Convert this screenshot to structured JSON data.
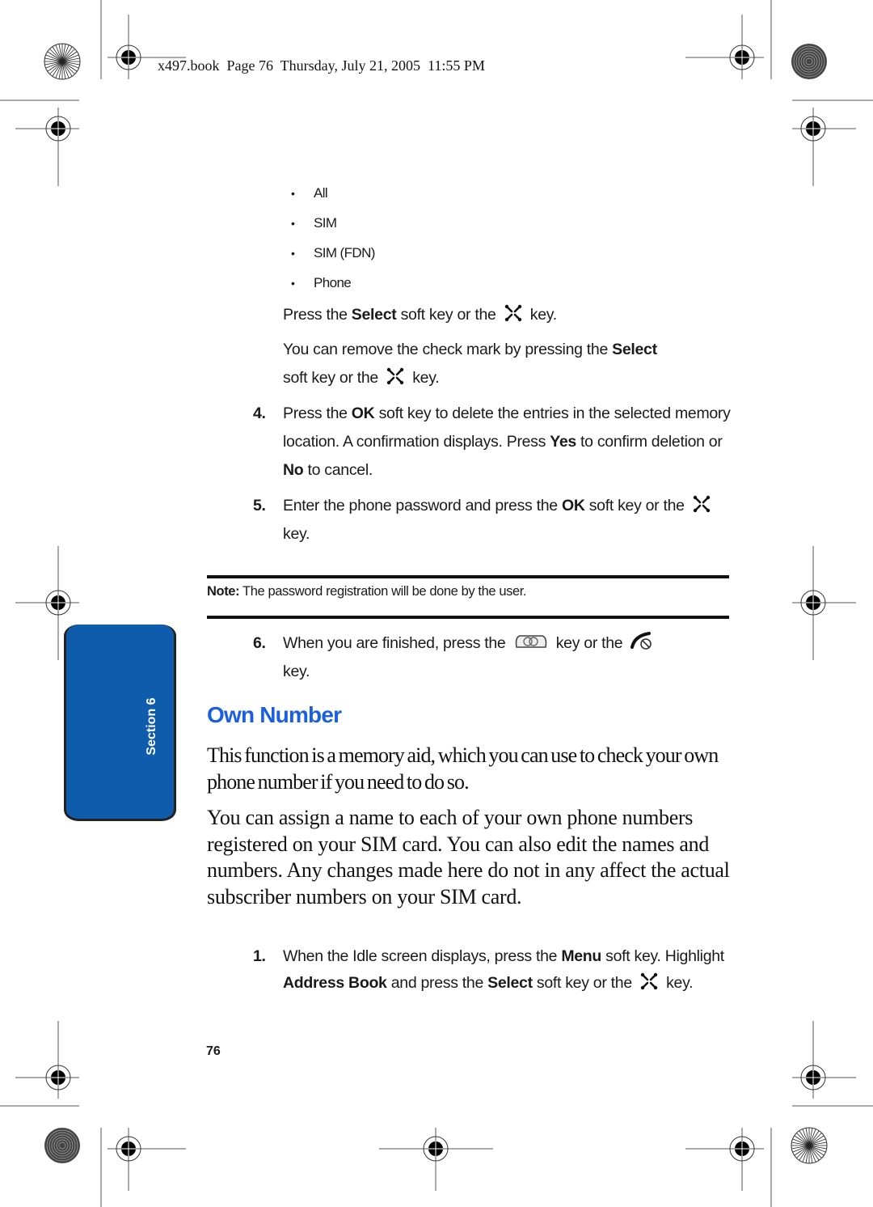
{
  "header": {
    "running_head": "x497.book  Page 76  Thursday, July 21, 2005  11:55 PM"
  },
  "bullets": [
    "All",
    "SIM",
    "SIM (FDN)",
    "Phone"
  ],
  "press_select": {
    "pre": "Press the ",
    "bold": "Select",
    "mid": " soft key or the ",
    "post": " key."
  },
  "remove_check": {
    "pre": "You can remove the check mark by pressing the ",
    "bold": "Select",
    "line2_pre": "soft key or the ",
    "post": " key."
  },
  "steps_top": [
    {
      "number": "4.",
      "parts": [
        "Press the ",
        "OK",
        " soft key to delete the entries in the selected memory location. A confirmation displays. Press ",
        "Yes",
        " to confirm deletion or ",
        "No",
        " to cancel."
      ]
    },
    {
      "number": "5.",
      "parts": [
        "Enter the phone password and press the ",
        "OK",
        " soft key or the ",
        " key."
      ]
    },
    {
      "number": "6.",
      "parts": [
        "When you are finished, press the ",
        " key or the ",
        " key."
      ]
    }
  ],
  "note": {
    "label": "Note:",
    "text": " The password registration will be done by the user."
  },
  "section_tab": {
    "label": "Section 6",
    "color": "#0f5cad"
  },
  "section": {
    "title": "Own Number",
    "title_color": "#1a5fe0",
    "paragraphs": [
      "This function is a memory aid, which you can use to check your own phone number if you need to do so.",
      "You can assign a name to each of your own phone numbers registered on your SIM card. You can also edit the names and numbers. Any changes made here do not in any affect the actual subscriber numbers on your SIM card."
    ]
  },
  "steps_bottom": [
    {
      "number": "1.",
      "parts": [
        "When the Idle screen displays, press the ",
        "Menu",
        " soft key. Highlight ",
        "Address Book",
        " and press the ",
        "Select",
        " soft key or the ",
        " key."
      ]
    }
  ],
  "icons": {
    "nav_key": "navigation-key-icon",
    "clear_key": "clear-key-icon",
    "end_key": "end-call-key-icon"
  },
  "footer": {
    "page_number": "76"
  }
}
